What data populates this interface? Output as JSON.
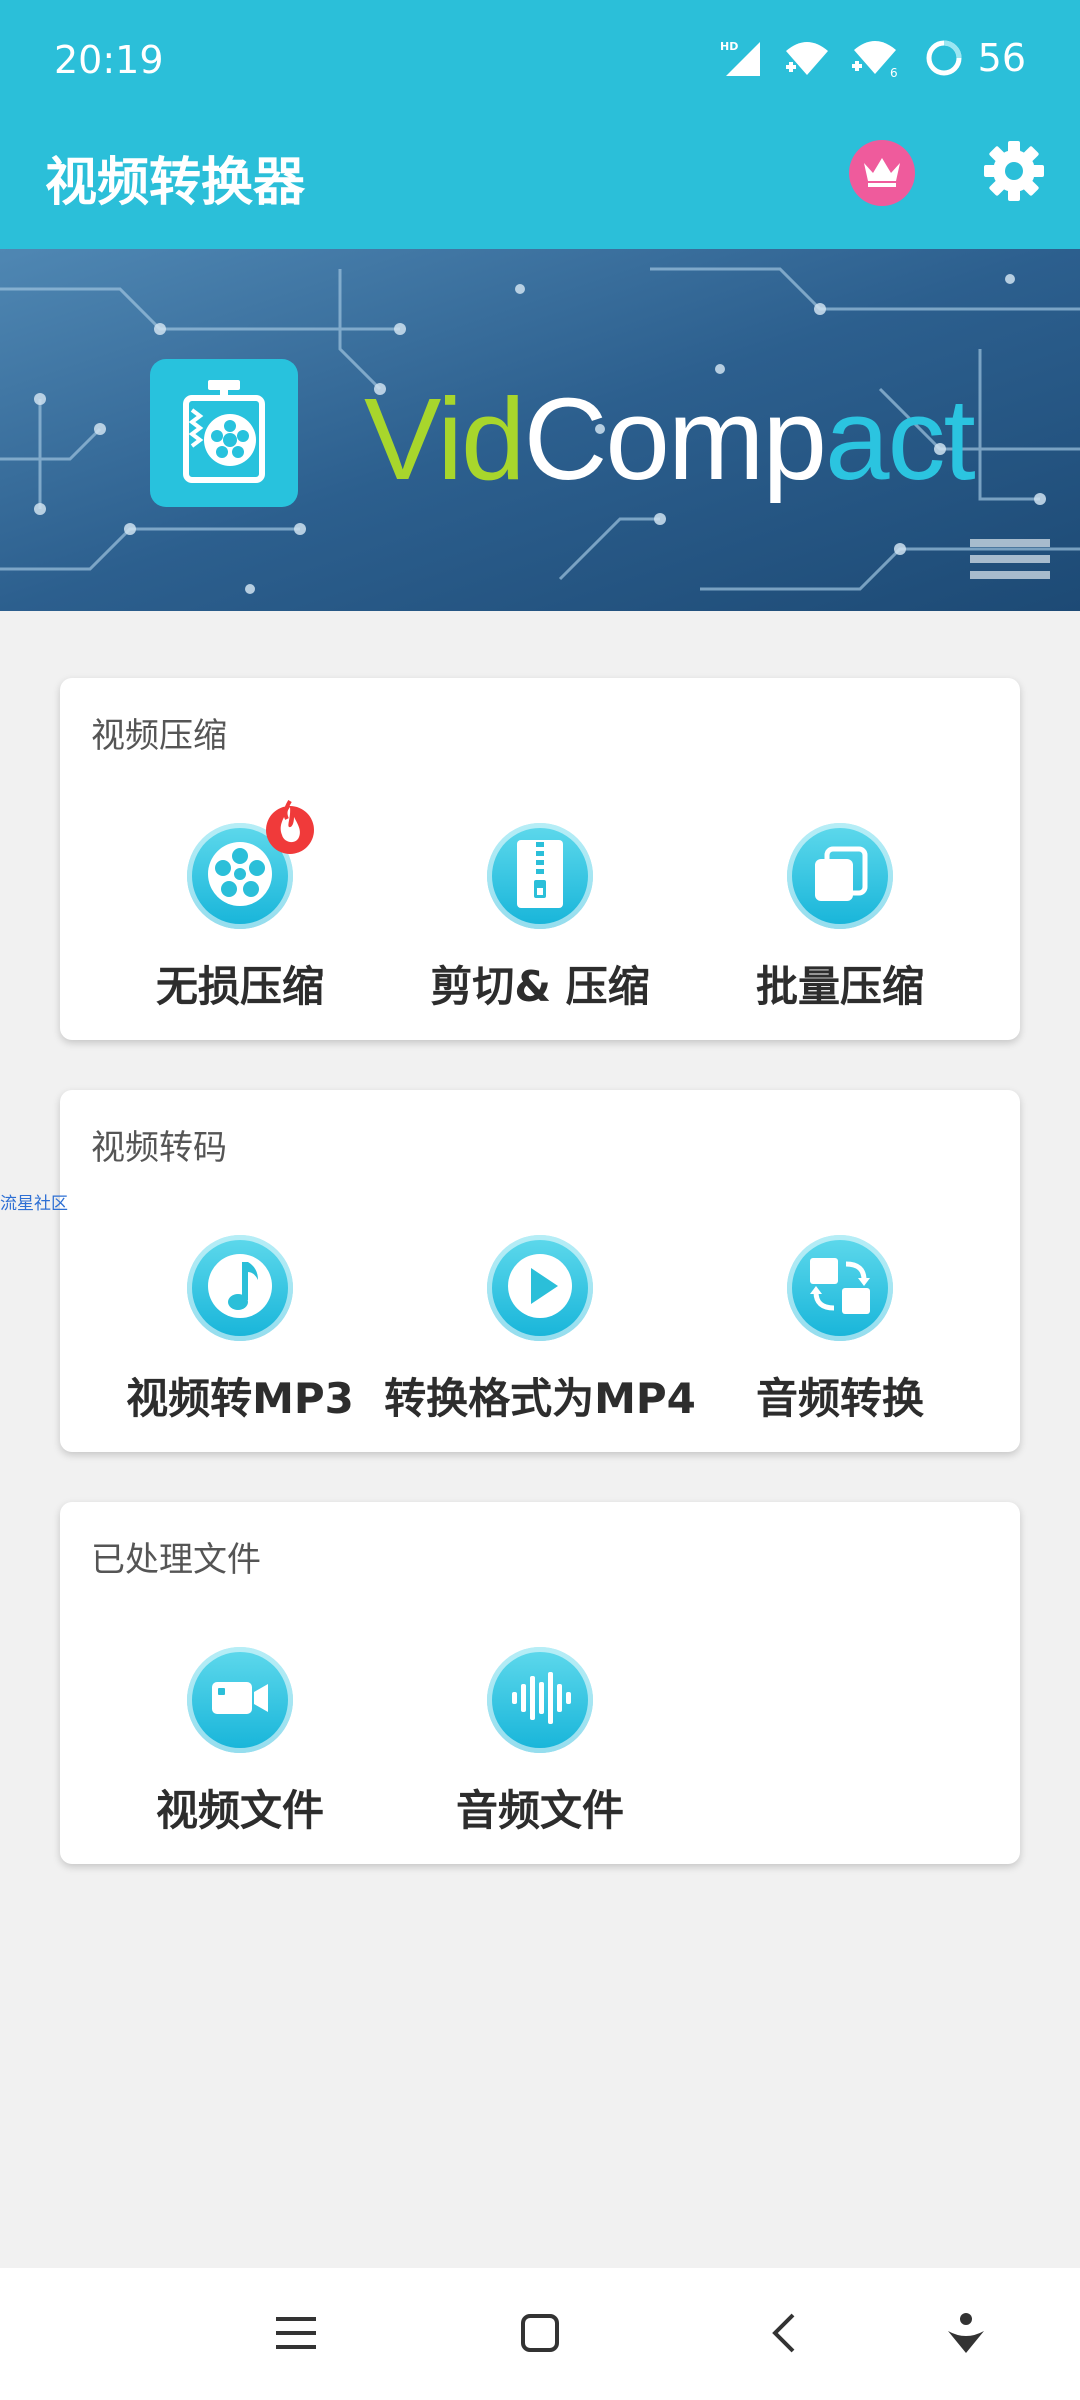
{
  "status_bar": {
    "time": "20:19",
    "battery": "56",
    "icons": [
      "hd-signal-icon",
      "wifi-icon",
      "wifi-6-icon",
      "battery-ring-icon"
    ]
  },
  "app_bar": {
    "title": "视频转换器",
    "vip_icon": "crown-icon",
    "settings_icon": "gear-icon"
  },
  "banner": {
    "brand_part1": "Vid",
    "brand_part2": "Comp",
    "brand_part3": "act",
    "colors": {
      "vid": "#a8d62c",
      "comp": "#ffffff",
      "act": "#2bc4e0"
    }
  },
  "sections": {
    "compress": {
      "title": "视频压缩",
      "items": [
        {
          "label": "无损压缩",
          "icon": "film-reel-icon",
          "badge": "fire-icon"
        },
        {
          "label": "剪切& 压缩",
          "icon": "zip-icon"
        },
        {
          "label": "批量压缩",
          "icon": "stacked-pages-icon"
        }
      ]
    },
    "convert": {
      "title": "视频转码",
      "items": [
        {
          "label": "视频转MP3",
          "icon": "music-note-icon"
        },
        {
          "label": "转换格式为MP4",
          "icon": "play-icon"
        },
        {
          "label": "音频转换",
          "icon": "swap-icon"
        }
      ]
    },
    "processed": {
      "title": "已处理文件",
      "items": [
        {
          "label": "视频文件",
          "icon": "video-camera-icon"
        },
        {
          "label": "音频文件",
          "icon": "waveform-icon"
        }
      ]
    }
  },
  "watermark": "流星社区",
  "nav_bar": {
    "buttons": [
      "menu-icon",
      "home-icon",
      "back-icon",
      "assistant-icon"
    ]
  },
  "theme": {
    "primary": "#2bbfd9",
    "background": "#f1f1f1"
  }
}
